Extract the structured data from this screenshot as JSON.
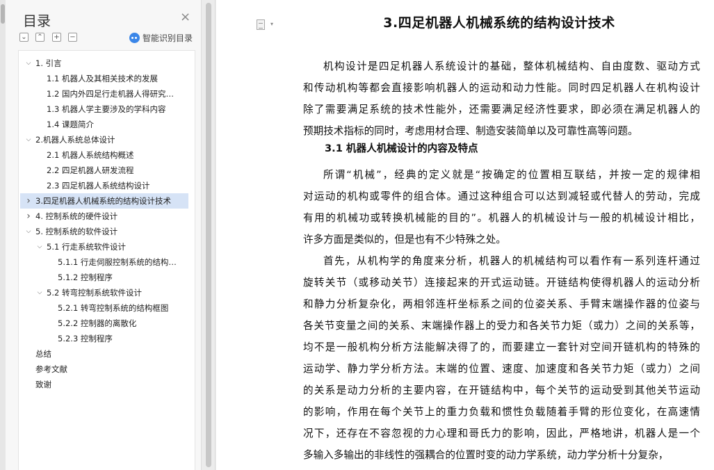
{
  "toc": {
    "title": "目录",
    "close": "×",
    "toolbar": {
      "expand": "⌄",
      "collapse": "⌃",
      "add": "+",
      "remove": "−"
    },
    "smart_label": "智能识别目录",
    "items": [
      {
        "label": "1. 引言",
        "level": 1,
        "arrow": "v"
      },
      {
        "label": "1.1 机器人及其相关技术的发展",
        "level": 2
      },
      {
        "label": "1.2 国内外四足行走机器人得研究…",
        "level": 2
      },
      {
        "label": "1.3 机器人学主要涉及的学科内容",
        "level": 2
      },
      {
        "label": "1.4  课题简介",
        "level": 2
      },
      {
        "label": "2.机器人系统总体设计",
        "level": 1,
        "arrow": "v"
      },
      {
        "label": "2.1 机器人系统结构概述",
        "level": 2
      },
      {
        "label": "2.2  四足机器人研发流程",
        "level": 2
      },
      {
        "label": "2.3 四足机器人系统结构设计",
        "level": 2
      },
      {
        "label": "3.四足机器人机械系统的结构设计技术",
        "level": 1,
        "arrow": ">",
        "selected": true
      },
      {
        "label": "4. 控制系统的硬件设计",
        "level": 1,
        "arrow": ">"
      },
      {
        "label": "5. 控制系统的软件设计",
        "level": 1,
        "arrow": "v"
      },
      {
        "label": "5.1  行走系统软件设计",
        "level": 2,
        "arrow": "v"
      },
      {
        "label": "5.1.1    行走伺服控制系统的结构…",
        "level": 3
      },
      {
        "label": "5.1.2 控制程序",
        "level": 3
      },
      {
        "label": "5.2 转弯控制系统软件设计",
        "level": 2,
        "arrow": "v"
      },
      {
        "label": "5.2.1 转弯控制系统的结构框图",
        "level": 3
      },
      {
        "label": "5.2.2  控制器的离散化",
        "level": 3
      },
      {
        "label": "5.2.3  控制程序",
        "level": 3
      },
      {
        "label": "总结",
        "level": 0
      },
      {
        "label": "参考文献",
        "level": 0
      },
      {
        "label": "致谢",
        "level": 0
      }
    ]
  },
  "doc": {
    "title": "3.四足机器人机械系统的结构设计技术",
    "section_heading": "3.1  机器人机械设计的内容及特点",
    "para1": [
      "机构设计是四足机器人系统设计的基础，整体机械结构、自由度数、驱动方式",
      "和传动机构等都会直接影响机器人的运动和动力性能。同时四足机器人在机构设计",
      "除了需要满足系统的技术性能外，还需要满足经济性要求，即必须在满足机器人的",
      "预期技术指标的同时，考虑用材合理、制造安装简单以及可靠性高等问题。"
    ],
    "para2": [
      "所谓“机械”，经典的定义就是“按确定的位置相互联结，并按一定的规律相",
      "对运动的机构或零件的组合体。通过这种组合可以达到减轻或代替人的劳动，完成",
      "有用的机械功或转换机械能的目的”。机器人的机械设计与一般的机械设计相比，",
      "许多方面是类似的，但是也有不少特殊之处。"
    ],
    "para3": [
      "首先，从机构学的角度来分析，机器人的机械结构可以看作有一系列连杆通过",
      "旋转关节（或移动关节）连接起来的开式运动链。开链结构使得机器人的运动分析",
      "和静力分析复杂化，两相邻连杆坐标系之间的位姿关系、手臂末端操作器的位姿与",
      "各关节变量之间的关系、末端操作器上的受力和各关节力矩（或力）之间的关系等，",
      "均不是一般机构分析方法能解决得了的，而要建立一套针对空间开链机构的特殊的",
      "运动学、静力学分析方法。末端的位置、速度、加速度和各关节力矩（或力）之间",
      "的关系是动力分析的主要内容，在开链结构中，每个关节的运动受到其他关节运动",
      "的影响，作用在每个关节上的重力负载和惯性负载随着手臂的形位变化，在高速情",
      "况下，还存在不容忽视的力心理和哥氏力的影响，因此，严格地讲，机器人是一个",
      "多输入多输出的非线性的强耦合的位置时变的动力学系统，动力学分析十分复杂，"
    ]
  }
}
